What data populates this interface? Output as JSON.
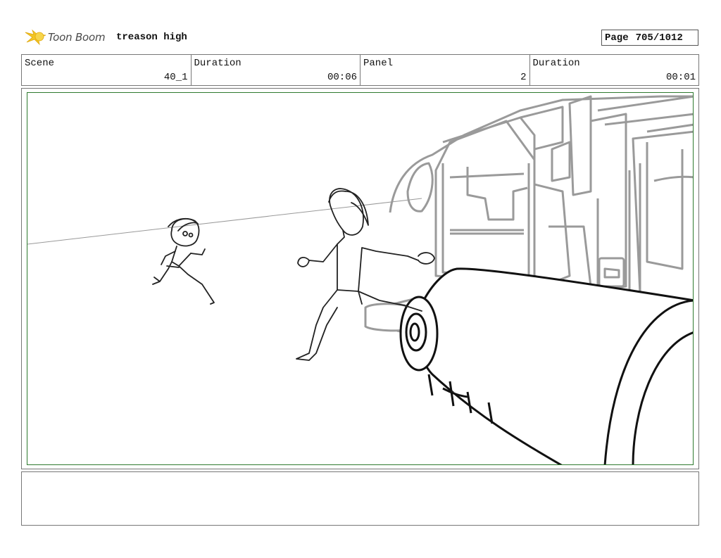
{
  "header": {
    "logo_text": "Toon Boom",
    "project_title": "treason high",
    "page_label": "Page",
    "page_number": "705/1012"
  },
  "info": {
    "scene_label": "Scene",
    "scene_value": "40_1",
    "scene_duration_label": "Duration",
    "scene_duration_value": "00:06",
    "panel_label": "Panel",
    "panel_value": "2",
    "panel_duration_label": "Duration",
    "panel_duration_value": "00:01"
  },
  "notes": {
    "text": ""
  }
}
